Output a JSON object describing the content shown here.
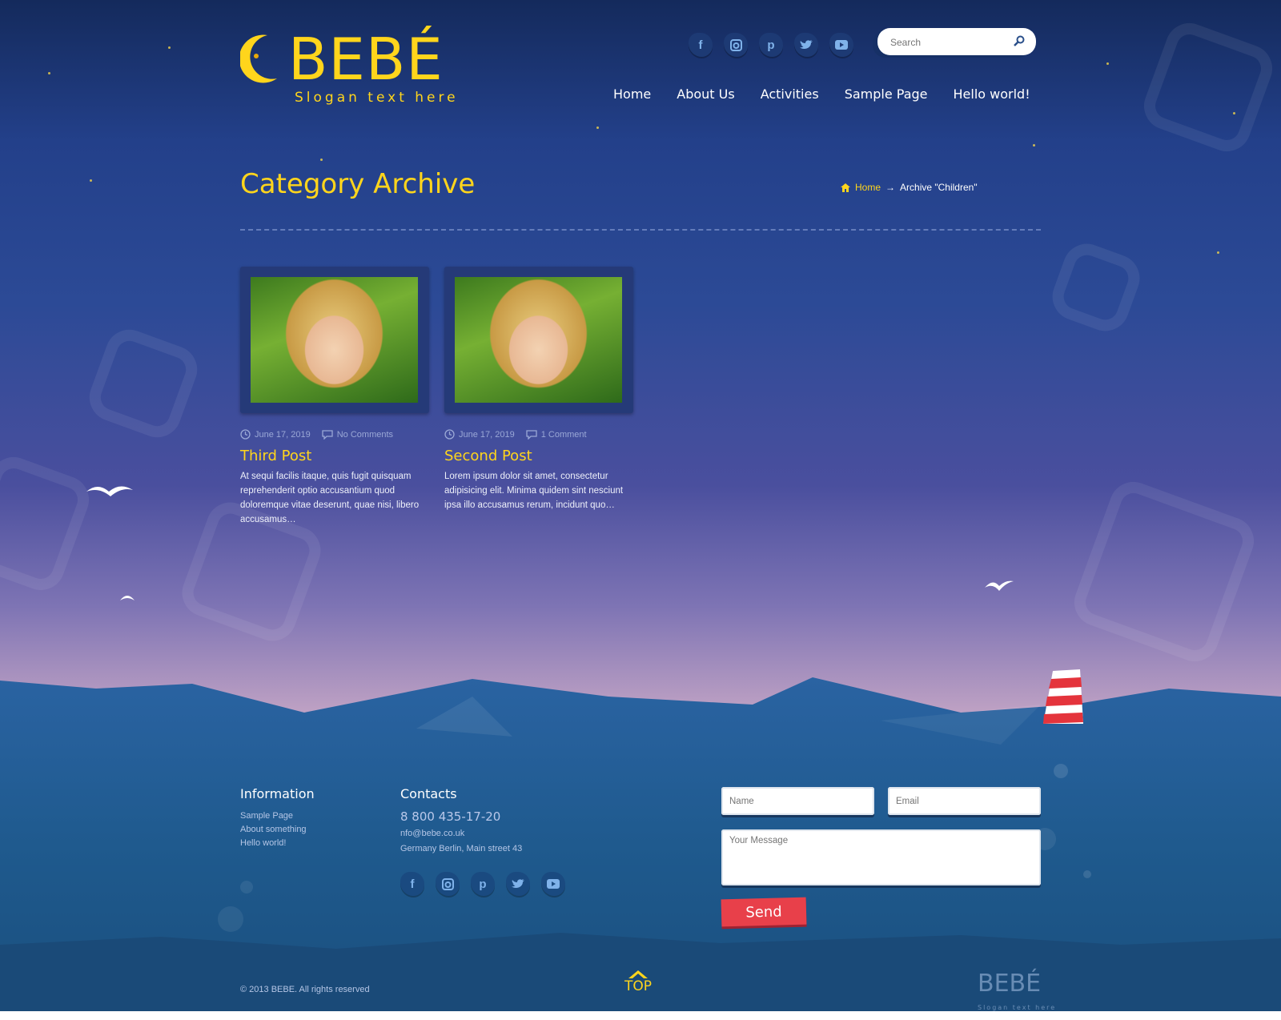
{
  "brand": {
    "name": "BEBÉ",
    "slogan": "Slogan text here"
  },
  "header": {
    "social_icons": [
      "facebook-icon",
      "instagram-icon",
      "pinterest-icon",
      "twitter-icon",
      "youtube-icon"
    ],
    "search": {
      "placeholder": "Search"
    },
    "nav": [
      "Home",
      "About Us",
      "Activities",
      "Sample Page",
      "Hello world!"
    ]
  },
  "page": {
    "title": "Category Archive",
    "breadcrumb": {
      "home": "Home",
      "separator": "→",
      "current": "Archive \"Children\""
    }
  },
  "posts": [
    {
      "date": "June 17, 2019",
      "comments": "No Comments",
      "title": "Third Post",
      "excerpt": "At sequi facilis itaque, quis fugit quisquam reprehenderit optio accusantium quod doloremque vitae deserunt, quae nisi, libero accusamus…"
    },
    {
      "date": "June 17, 2019",
      "comments": "1 Comment",
      "title": "Second Post",
      "excerpt": "Lorem ipsum dolor sit amet, consectetur adipisicing elit. Minima quidem sint nesciunt ipsa illo accusamus rerum, incidunt quo…"
    }
  ],
  "footer": {
    "information": {
      "heading": "Information",
      "links": [
        "Sample Page",
        "About something",
        "Hello world!"
      ]
    },
    "contacts": {
      "heading": "Contacts",
      "phone": "8 800 435-17-20",
      "email": "nfo@bebe.co.uk",
      "address": "Germany Berlin, Main street 43"
    },
    "form": {
      "name_placeholder": "Name",
      "email_placeholder": "Email",
      "message_placeholder": "Your Message",
      "send_label": "Send"
    },
    "copyright": "© 2013 BEBE. All rights reserved",
    "top_label": "TOP",
    "logo": {
      "name": "BEBÉ",
      "slogan": "Slogan text here"
    }
  },
  "colors": {
    "accent": "#ffd51c",
    "send_button": "#e8404a",
    "sky_top": "#142a5c",
    "sea": "#1e5a8c"
  }
}
